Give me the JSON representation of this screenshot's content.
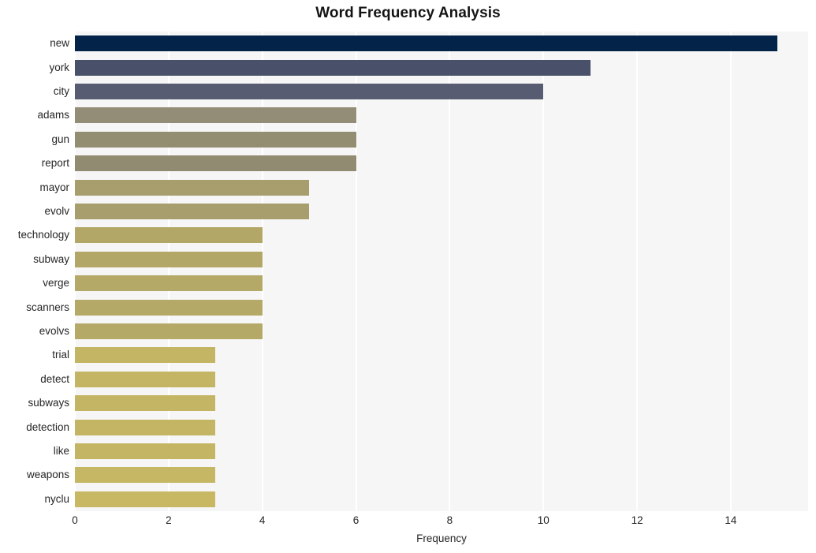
{
  "chart_data": {
    "type": "bar",
    "orientation": "horizontal",
    "title": "Word Frequency Analysis",
    "xlabel": "Frequency",
    "ylabel": "",
    "categories": [
      "new",
      "york",
      "city",
      "adams",
      "gun",
      "report",
      "mayor",
      "evolv",
      "technology",
      "subway",
      "verge",
      "scanners",
      "evolvs",
      "trial",
      "detect",
      "subways",
      "detection",
      "like",
      "weapons",
      "nyclu"
    ],
    "values": [
      15,
      11,
      10,
      6,
      6,
      6,
      5,
      5,
      4,
      4,
      4,
      4,
      4,
      3,
      3,
      3,
      3,
      3,
      3,
      3
    ],
    "bar_colors": [
      "#032349",
      "#495069",
      "#585c72",
      "#938d77",
      "#938d71",
      "#918b72",
      "#a89d6c",
      "#a89d6c",
      "#b3a768",
      "#b3a768",
      "#b5a968",
      "#b5a968",
      "#b5a968",
      "#c4b564",
      "#c4b564",
      "#c4b564",
      "#c4b564",
      "#c4b564",
      "#c5b764",
      "#c8b863"
    ],
    "xlim": [
      0,
      15.65
    ],
    "xticks": [
      0,
      2,
      4,
      6,
      8,
      10,
      12,
      14
    ],
    "xtick_labels": [
      "0",
      "2",
      "4",
      "6",
      "8",
      "10",
      "12",
      "14"
    ],
    "grid": "vertical",
    "grid_color": "#ffffff",
    "plot_background": "#f6f6f6",
    "figure_background": "#ffffff",
    "legend": null
  }
}
